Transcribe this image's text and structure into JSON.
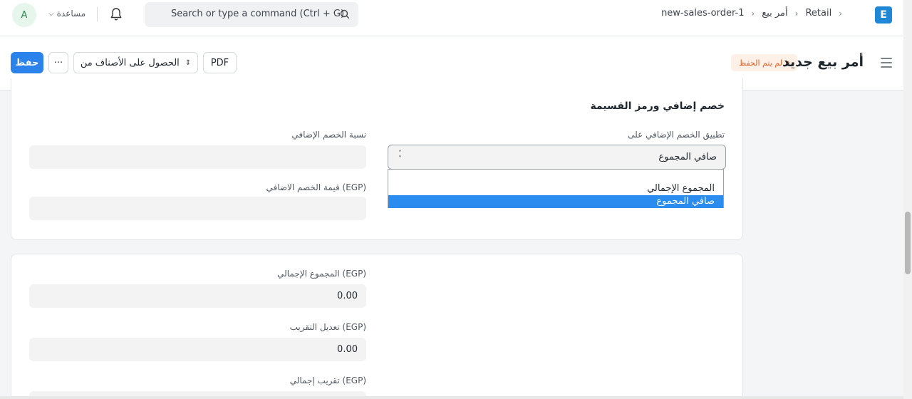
{
  "navbar": {
    "avatar_letter": "A",
    "help_label": "مساعدة",
    "search_placeholder": "Search or type a command (Ctrl + G)",
    "breadcrumb": [
      "Retail",
      "أمر بيع",
      "new-sales-order-1"
    ],
    "app_logo_letter": "E"
  },
  "page_header": {
    "title": "أمر بيع جديد",
    "status_badge": "لم يتم الحفظ",
    "buttons": {
      "save": "حفظ",
      "more": "···",
      "get_items": "الحصول على الأصناف من",
      "pdf": "PDF"
    }
  },
  "discount_section": {
    "title": "خصم إضافي ورمز القسيمة",
    "apply_discount_on": {
      "label": "تطبيق الخصم الإضافي على",
      "value": "صافي المجموع",
      "options": [
        "",
        "المجموع الإجمالي",
        "صافي المجموع"
      ],
      "selected_index": 2
    },
    "discount_percentage": {
      "label": "نسبة الخصم الإضافي",
      "value": ""
    },
    "discount_amount": {
      "label": "قيمة الخصم الاضافي (EGP)",
      "value": ""
    }
  },
  "totals_section": {
    "grand_total": {
      "label": "المجموع الإجمالي (EGP)",
      "value": "0.00"
    },
    "rounding_adjustment": {
      "label": "تعديل التقريب (EGP)",
      "value": "0.00"
    },
    "rounded_total": {
      "label": "تقريب إجمالي (EGP)",
      "value": ""
    }
  }
}
